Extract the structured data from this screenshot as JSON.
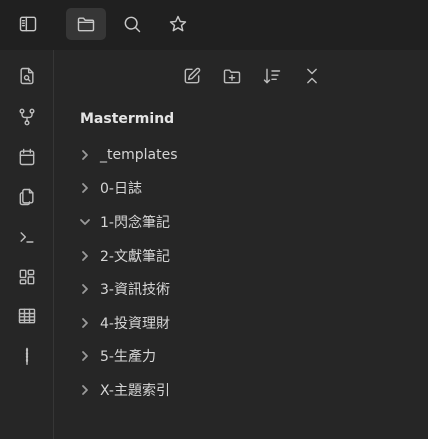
{
  "top_tabs": [
    {
      "name": "sidebar-toggle",
      "icon": "sidebar-toggle-icon"
    },
    {
      "name": "files",
      "icon": "folder-icon",
      "active": true
    },
    {
      "name": "search",
      "icon": "search-icon"
    },
    {
      "name": "bookmarks",
      "icon": "star-icon"
    }
  ],
  "ribbon_icons": [
    "open-quick-switcher-icon",
    "graph-view-icon",
    "daily-note-icon",
    "templates-icon",
    "command-palette-icon",
    "canvas-icon",
    "table-icon",
    "audio-recorder-icon"
  ],
  "nav_buttons": [
    "new-note-icon",
    "new-folder-icon",
    "sort-icon",
    "collapse-all-icon"
  ],
  "vault": {
    "name": "Mastermind"
  },
  "folders": [
    {
      "label": "_templates",
      "expanded": false
    },
    {
      "label": "0-日誌",
      "expanded": false
    },
    {
      "label": "1-閃念筆記",
      "expanded": true
    },
    {
      "label": "2-文獻筆記",
      "expanded": false
    },
    {
      "label": "3-資訊技術",
      "expanded": false
    },
    {
      "label": "4-投資理財",
      "expanded": false
    },
    {
      "label": "5-生產力",
      "expanded": false
    },
    {
      "label": "X-主題索引",
      "expanded": false
    }
  ],
  "colors": {
    "background": "#262626",
    "header": "#202020",
    "active_tab": "#363636",
    "text": "#d6d6d6"
  }
}
